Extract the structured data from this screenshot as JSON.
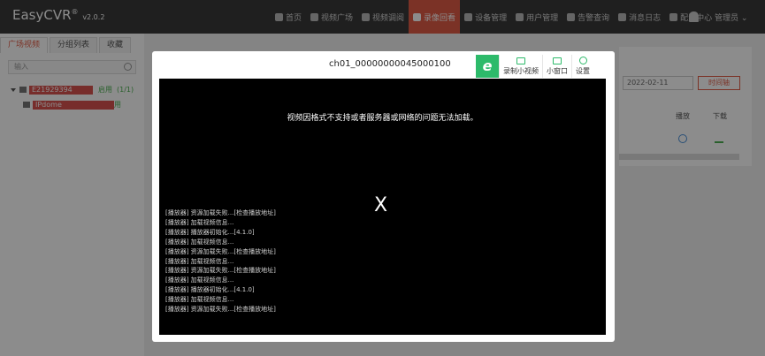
{
  "app": {
    "logo": "EasyCVR",
    "version": "v2.0.2"
  },
  "nav": {
    "items": [
      {
        "label": "首页",
        "active": false
      },
      {
        "label": "视频广场",
        "active": false
      },
      {
        "label": "视频调阅",
        "active": false
      },
      {
        "label": "录像回看",
        "active": true
      },
      {
        "label": "设备管理",
        "active": false
      },
      {
        "label": "用户管理",
        "active": false
      },
      {
        "label": "告警查询",
        "active": false
      },
      {
        "label": "消息日志",
        "active": false
      },
      {
        "label": "配置中心",
        "active": false
      }
    ],
    "admin": "管理员 ⌄"
  },
  "sidebar": {
    "tabs": [
      "广场视频",
      "分组列表",
      "收藏"
    ],
    "search_placeholder": "输入",
    "tree": {
      "node_label": "E21929394",
      "node_status": "启用",
      "node_count": "(1/1)",
      "child_label": "IPdome",
      "child_suffix": "用"
    }
  },
  "main": {
    "date": "2022-02-11",
    "timeline_button": "时间轴",
    "col_play": "播放",
    "col_download": "下载"
  },
  "modal": {
    "title": "ch01_00000000045000100",
    "logo_letter": "e",
    "tools": [
      {
        "label": "录制小视频",
        "icon": "record-icon"
      },
      {
        "label": "小窗口",
        "icon": "mini-window-icon"
      },
      {
        "label": "设置",
        "icon": "gear-icon"
      }
    ],
    "error_message": "视频因格式不支持或者服务器或网络的问题无法加载。",
    "close_glyph": "X",
    "log_lines": [
      "[播放器] 资源加载失败...[检查播放地址]",
      "[播放器] 加载视频信息...",
      "[播放器] 播放器初始化...[4.1.0]",
      "[播放器] 加载视频信息...",
      "[播放器] 资源加载失败...[检查播放地址]",
      "[播放器] 加载视频信息...",
      "[播放器] 资源加载失败...[检查播放地址]",
      "[播放器] 加载视频信息...",
      "[播放器] 播放器初始化...[4.1.0]",
      "[播放器] 加载视频信息...",
      "[播放器] 资源加载失败...[检查播放地址]"
    ]
  },
  "colors": {
    "accent": "#e05b45",
    "green": "#2dba6a",
    "topbar": "#3a3a3a"
  }
}
